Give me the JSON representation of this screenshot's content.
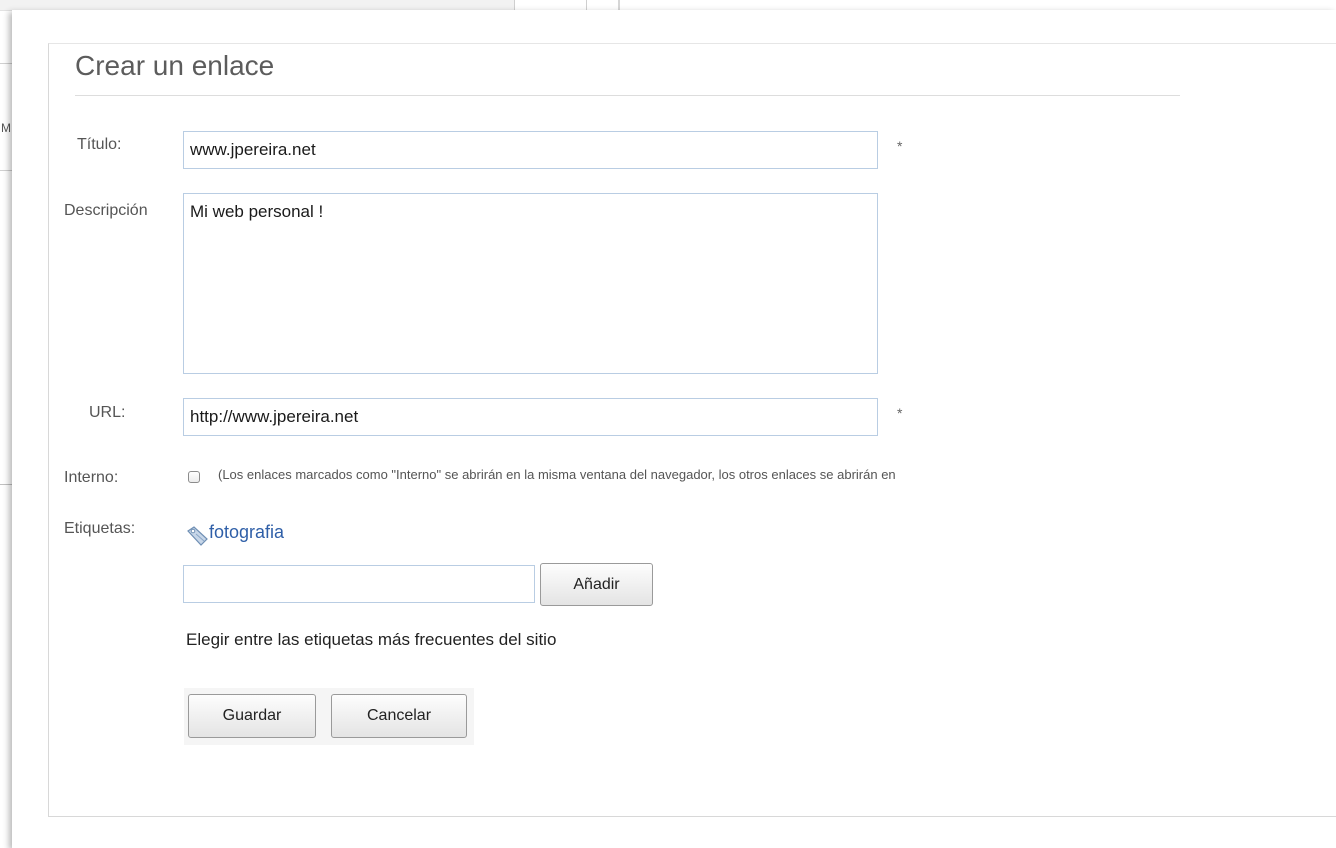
{
  "background": {
    "edge_letter": "M"
  },
  "form": {
    "title": "Crear un enlace",
    "required_mark": "*",
    "fields": {
      "titulo": {
        "label": "Título:",
        "value": "www.jpereira.net"
      },
      "descripcion": {
        "label": "Descripción",
        "value": "Mi web personal !"
      },
      "url": {
        "label": "URL:",
        "value": "http://www.jpereira.net"
      },
      "interno": {
        "label": "Interno:",
        "checked": false,
        "note": "(Los enlaces marcados como \"Interno\" se abrirán en la misma ventana del navegador, los otros enlaces se abrirán en"
      },
      "etiquetas": {
        "label": "Etiquetas:",
        "tags": [
          "fotografia"
        ],
        "tag_icon": "tag-icon",
        "new_tag_value": "",
        "add_label": "Añadir",
        "hint": "Elegir entre las etiquetas más frecuentes del sitio"
      }
    },
    "actions": {
      "save_label": "Guardar",
      "cancel_label": "Cancelar"
    }
  }
}
